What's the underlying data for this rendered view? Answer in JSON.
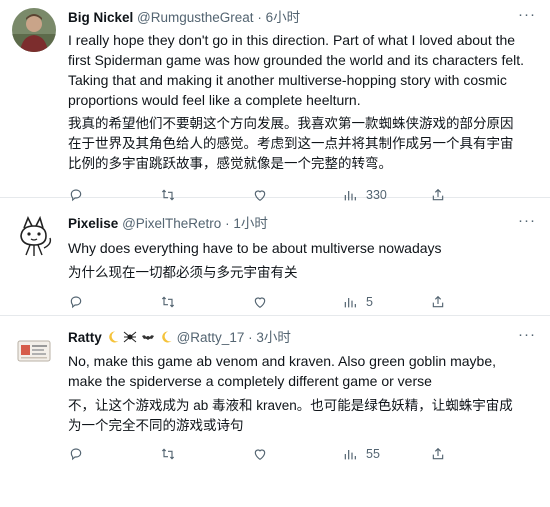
{
  "tweets": [
    {
      "name": "Big Nickel",
      "handle": "@RumgustheGreat",
      "time": "6小时",
      "text_lines": [
        "I really hope they don't go in this direction. Part of what I loved about the",
        "first Spiderman game was how grounded the world and its characters felt.",
        "Taking that and making it another multiverse-hopping story with cosmic",
        "proportions would feel like a complete heelturn."
      ],
      "cn_lines": [
        "我真的希望他们不要朝这个方向发展。我喜欢第一款蜘蛛侠游戏的部分原因",
        "在于世界及其角色给人的感觉。考虑到这一点并将其制作成另一个具有宇宙",
        "比例的多宇宙跳跃故事，感觉就像是一个完整的转弯。"
      ],
      "views": "330",
      "avatar_icon": "photo-avatar-icon"
    },
    {
      "name": "Pixelise",
      "handle": "@PixelTheRetro",
      "time": "1小时",
      "text_lines": [
        "Why does everything have to be about multiverse nowadays"
      ],
      "cn_lines": [
        "为什么现在一切都必须与多元宇宙有关"
      ],
      "views": "5",
      "avatar_icon": "sketch-cat-avatar-icon"
    },
    {
      "name": "Ratty",
      "handle": "@Ratty_17",
      "time": "3小时",
      "text_lines": [
        "No, make this game ab venom and kraven. Also green goblin maybe,",
        "make the spiderverse a completely different game or verse"
      ],
      "cn_lines": [
        "不，让这个游戏成为 ab 毒液和 kraven。也可能是绿色妖精，让蜘蛛宇宙成",
        "为一个完全不同的游戏或诗句"
      ],
      "views": "55",
      "avatar_icon": "id-card-avatar-icon"
    }
  ],
  "separator": "·",
  "more_label": "···",
  "colors": {
    "text": "#0f1419",
    "secondary": "#536471",
    "divider": "#e6e9ec"
  },
  "action_icons": [
    "reply-icon",
    "retweet-icon",
    "like-icon",
    "views-icon",
    "share-icon"
  ]
}
